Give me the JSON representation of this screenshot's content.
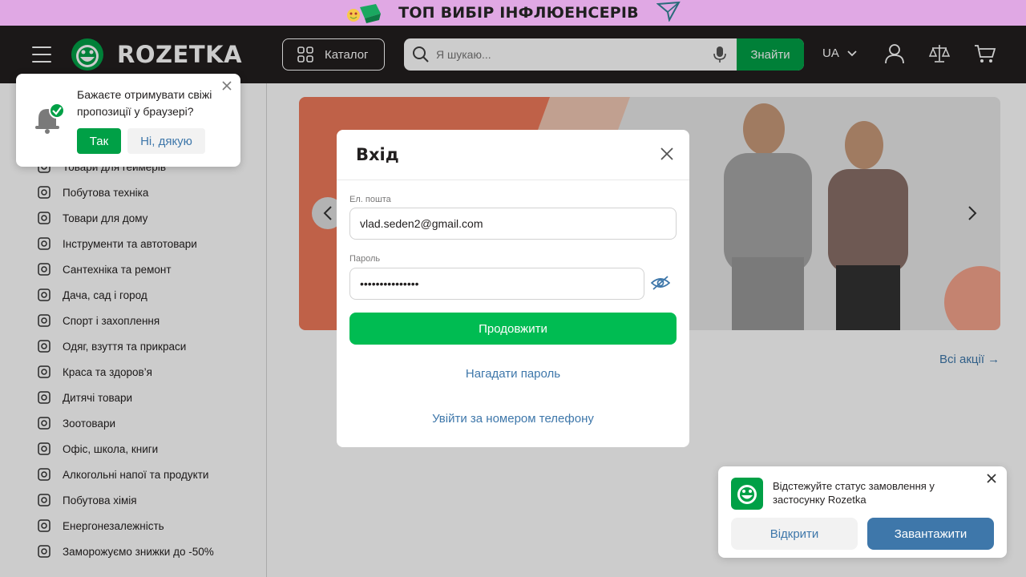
{
  "promo": {
    "title": "ТОП ВИБІР ІНФЛЮЕНСЕРІВ",
    "bg": "#e0a8e4"
  },
  "header": {
    "logo": "ROZETKA",
    "catalog_label": "Каталог",
    "search_placeholder": "Я шукаю...",
    "search_button": "Знайти",
    "language": "UA"
  },
  "push": {
    "message": "Бажаєте отримувати свіжі пропозиції у браузері?",
    "yes": "Так",
    "no": "Ні, дякую"
  },
  "sidebar": {
    "items": [
      {
        "label": "Товари для геймерів",
        "icon": "gamepad-icon"
      },
      {
        "label": "Побутова техніка",
        "icon": "washer-icon"
      },
      {
        "label": "Товари для дому",
        "icon": "sofa-icon"
      },
      {
        "label": "Інструменти та автотовари",
        "icon": "drill-icon"
      },
      {
        "label": "Сантехніка та ремонт",
        "icon": "bath-icon"
      },
      {
        "label": "Дача, сад і город",
        "icon": "garden-icon"
      },
      {
        "label": "Спорт і захоплення",
        "icon": "racket-icon"
      },
      {
        "label": "Одяг, взуття та прикраси",
        "icon": "shirt-icon"
      },
      {
        "label": "Краса та здоров’я",
        "icon": "cosmetics-icon"
      },
      {
        "label": "Дитячі товари",
        "icon": "teddy-bear-icon"
      },
      {
        "label": "Зоотовари",
        "icon": "paw-icon"
      },
      {
        "label": "Офіс, школа, книги",
        "icon": "paperclip-icon"
      },
      {
        "label": "Алкогольні напої та продукти",
        "icon": "cocktail-icon"
      },
      {
        "label": "Побутова хімія",
        "icon": "detergent-icon"
      },
      {
        "label": "Енергонезалежність",
        "icon": "battery-icon"
      },
      {
        "label": "Заморожуємо знижки до -50%",
        "icon": "tag-icon"
      }
    ]
  },
  "main": {
    "all_promos": "Всі акції →"
  },
  "modal": {
    "title": "Вхід",
    "email_label": "Ел. пошта",
    "email_value": "vlad.seden2@gmail.com",
    "password_label": "Пароль",
    "password_value": "•••••••••••••••",
    "submit": "Продовжити",
    "forgot": "Нагадати пароль",
    "phone_login": "Увійти за номером телефону"
  },
  "app_promo": {
    "text": "Відстежуйте статус замовлення у застосунку Rozetka",
    "open": "Відкрити",
    "download": "Завантажити"
  }
}
